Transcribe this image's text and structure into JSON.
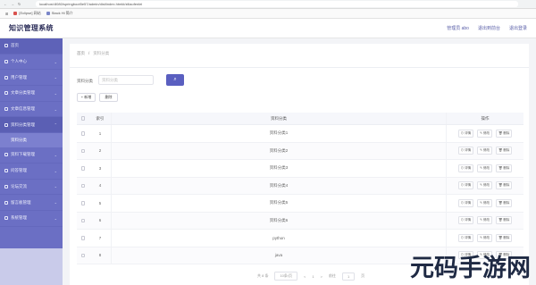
{
  "browser": {
    "url": "localhost:8080/springboot5e57/admin/dist/index.html#/ziliaofenlei",
    "bookmarks": [
      "[Eclipse] 网站",
      "Stack Hi 简介"
    ]
  },
  "topbar": {
    "brand": "知识管理系统",
    "user": "管理员 abo",
    "links": [
      "退出到前台",
      "退出登录"
    ]
  },
  "sidebar": {
    "items": [
      {
        "label": "首页",
        "chev": ""
      },
      {
        "label": "个人中心",
        "chev": "⌄"
      },
      {
        "label": "用户管理",
        "chev": "⌄"
      },
      {
        "label": "文章分类管理",
        "chev": "⌄"
      },
      {
        "label": "文章信息管理",
        "chev": "⌄"
      },
      {
        "label": "资料分类管理",
        "chev": "⌃"
      }
    ],
    "sub_item": "资料分类",
    "items_after": [
      {
        "label": "资料下载管理",
        "chev": "⌄"
      },
      {
        "label": "问答管理",
        "chev": "⌄"
      },
      {
        "label": "论坛交流",
        "chev": "⌄"
      },
      {
        "label": "留言板管理",
        "chev": "⌄"
      },
      {
        "label": "系统管理",
        "chev": "⌄"
      }
    ]
  },
  "breadcrumb": {
    "home": "首页",
    "sep": "/",
    "current": "资料分类"
  },
  "search": {
    "label": "资料分类",
    "placeholder": "资料分类",
    "button_icon": "⌕"
  },
  "actions": {
    "add": "+ 新增",
    "delete": "删除"
  },
  "table": {
    "headers": {
      "index": "索引",
      "name": "资料分类",
      "ops": "操作"
    },
    "rows": [
      {
        "idx": "1",
        "name": "资料分类1"
      },
      {
        "idx": "2",
        "name": "资料分类2"
      },
      {
        "idx": "3",
        "name": "资料分类3"
      },
      {
        "idx": "4",
        "name": "资料分类4"
      },
      {
        "idx": "5",
        "name": "资料分类5"
      },
      {
        "idx": "6",
        "name": "资料分类6"
      },
      {
        "idx": "7",
        "name": "python"
      },
      {
        "idx": "8",
        "name": "java"
      }
    ],
    "ops": {
      "detail": "⊙ 详情",
      "edit": "✎ 修改",
      "delete": "🗑 删除"
    }
  },
  "pager": {
    "total": "共 8 条",
    "size": "10条/页",
    "prev": "<",
    "page": "1",
    "next": ">",
    "goto": "前往",
    "goto_page": "1",
    "page_suffix": "页"
  },
  "watermark": "元码手游网"
}
